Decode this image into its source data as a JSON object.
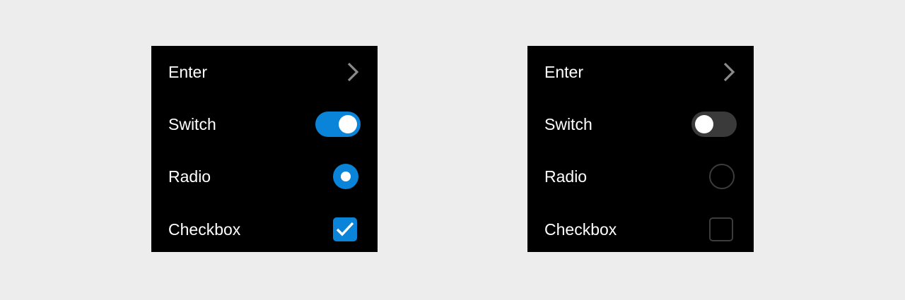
{
  "colors": {
    "background": "#ededed",
    "panel": "#000000",
    "text": "#ffffff",
    "accent": "#0a84d8",
    "inactive_track": "#3a3a3a",
    "inactive_outline": "#3c3c3c",
    "chevron": "#8a8a8a"
  },
  "panels": [
    {
      "state": "checked",
      "rows": {
        "enter": {
          "label": "Enter",
          "icon": "chevron-right-icon"
        },
        "switch": {
          "label": "Switch",
          "on": true
        },
        "radio": {
          "label": "Radio",
          "selected": true
        },
        "checkbox": {
          "label": "Checkbox",
          "checked": true
        }
      }
    },
    {
      "state": "unchecked",
      "rows": {
        "enter": {
          "label": "Enter",
          "icon": "chevron-right-icon"
        },
        "switch": {
          "label": "Switch",
          "on": false
        },
        "radio": {
          "label": "Radio",
          "selected": false
        },
        "checkbox": {
          "label": "Checkbox",
          "checked": false
        }
      }
    }
  ]
}
